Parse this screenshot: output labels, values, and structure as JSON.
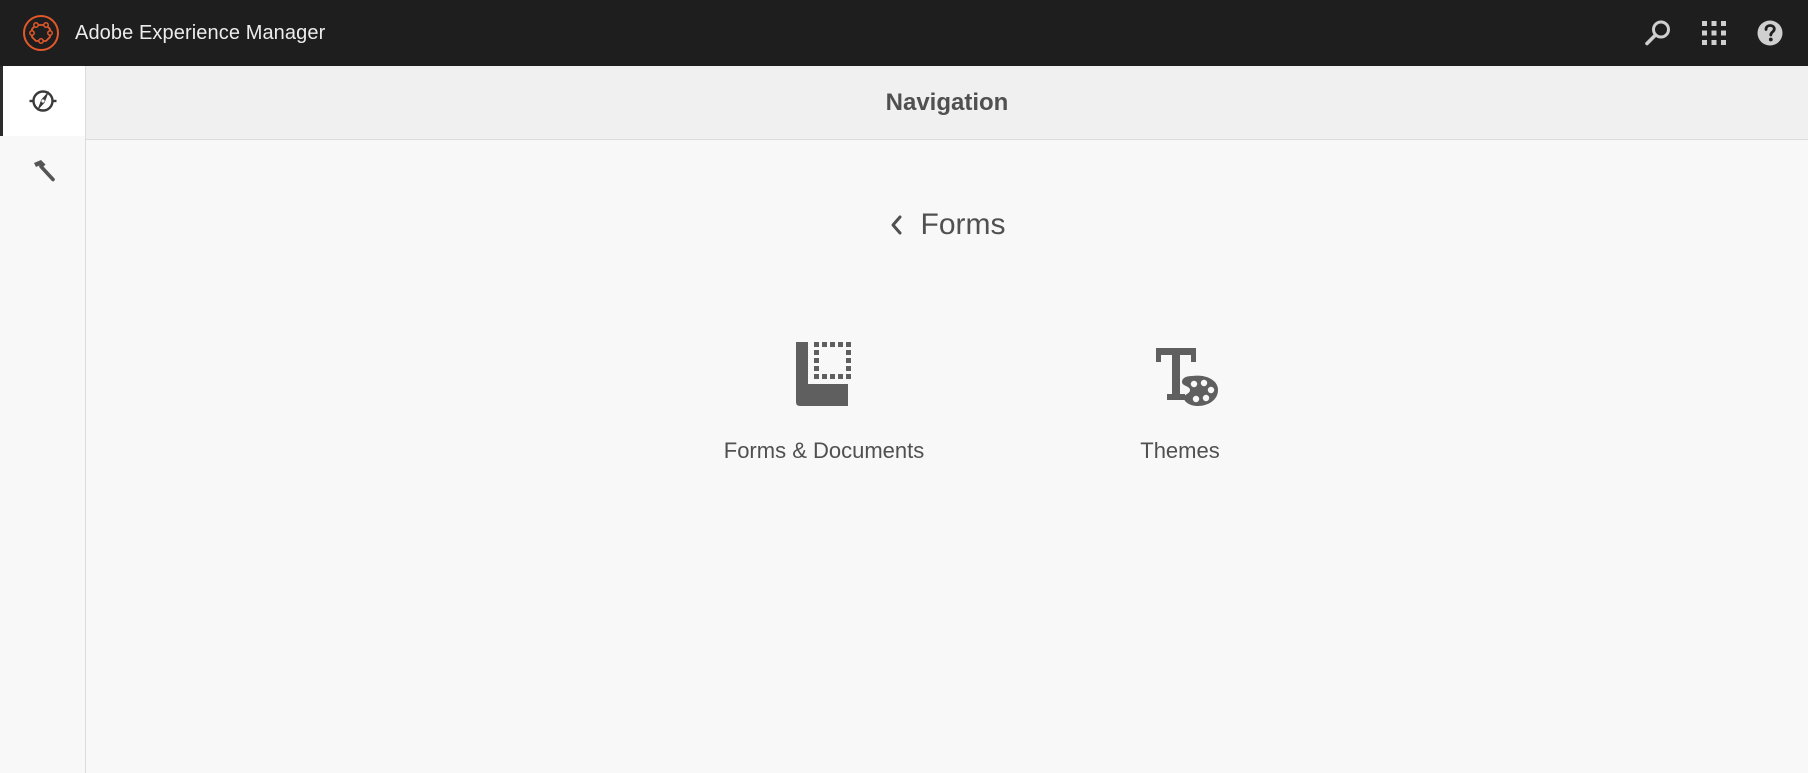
{
  "app": {
    "title": "Adobe Experience Manager",
    "brand_color": "#e1582a"
  },
  "topbar": {
    "icons": [
      "search-icon",
      "apps-grid-icon",
      "help-icon"
    ]
  },
  "rail": {
    "items": [
      {
        "name": "navigation",
        "icon": "compass-icon",
        "active": true
      },
      {
        "name": "tools",
        "icon": "hammer-icon",
        "active": false
      }
    ]
  },
  "main": {
    "header_title": "Navigation",
    "breadcrumb_label": "Forms",
    "tiles": [
      {
        "label": "Forms & Documents",
        "icon": "forms-documents-icon"
      },
      {
        "label": "Themes",
        "icon": "themes-palette-icon"
      }
    ]
  }
}
